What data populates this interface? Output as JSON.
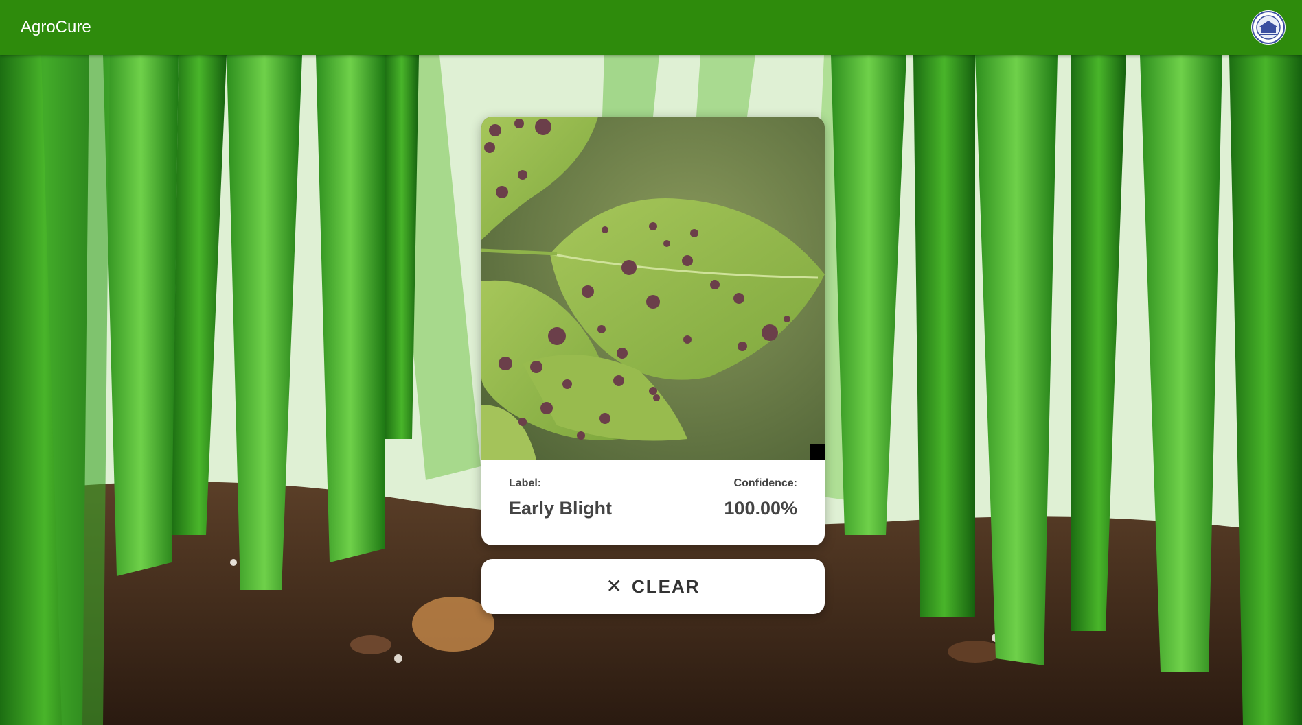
{
  "app": {
    "title": "AgroCure",
    "logo_icon": "university-seal-icon",
    "bar_color": "#2e8b0c"
  },
  "result": {
    "label_caption": "Label:",
    "label_value": "Early Blight",
    "confidence_caption": "Confidence:",
    "confidence_value": "100.00%"
  },
  "actions": {
    "clear_label": "CLEAR",
    "clear_icon": "close-icon",
    "clear_glyph": "✕"
  }
}
